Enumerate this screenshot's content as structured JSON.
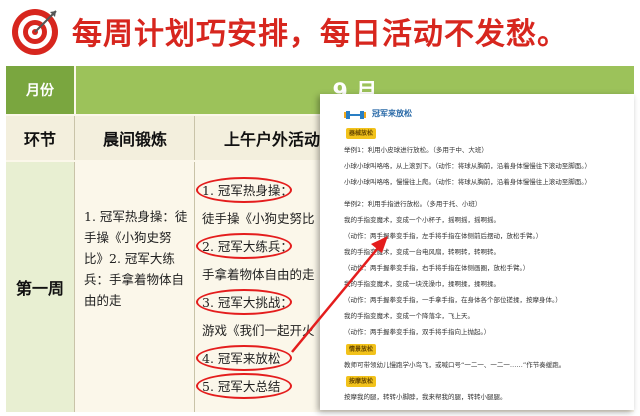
{
  "header": {
    "title": "每周计划巧安排，每日活动不发愁。"
  },
  "table": {
    "month_label": "月份",
    "month_value": "9 月",
    "col_section": "环节",
    "col_morning": "晨间锻炼",
    "col_outdoor": "上午户外活动",
    "week_label": "第一周",
    "morning_text": "1. 冠军热身操：徒手操《小狗史努比》2. 冠军大练兵：手拿着物体自由的走",
    "outdoor_lines": [
      "1. 冠军热身操：",
      "徒手操《小狗史努比",
      "2. 冠军大练兵：",
      "手拿着物体自由的走",
      "3. 冠军大挑战：",
      "游戏《我们一起开火",
      "4. 冠军来放松",
      "5. 冠军大总结"
    ]
  },
  "panel": {
    "title": "冠军来放松",
    "tag_1": "器械放松",
    "tag_2": "情景放松",
    "tag_3": "按摩放松",
    "lines": [
      "举例1：利用小皮球进行放松。（多用于中、大班）",
      "小球小球叫咯咯，从上滚到下。（动作：将球从胸前，沿着身体慢慢往下滚动至脚面。）",
      "小球小球叫咯咯，慢慢往上爬。（动作：将球从胸前，沿着身体慢慢往上滚动至脚面。）",
      "举例2：利用手指进行放松。（多用于托、小班）",
      "我的手指变魔术，变成一个小杯子，摇啊摇，摇啊摇。",
      "（动作：两手握拳变手指，左手将手指在体侧前后摆动，放松手臂。）",
      "我的手指变魔术，变成一台电风扇，转啊转，转啊转。",
      "（动作：两手握拳变手指，右手将手指在体侧画圈，放松手臂。）",
      "我的手指变魔术，变成一块洗澡巾，揉啊揉，揉啊揉。",
      "（动作：两手握拳变手指，一手拿手指，在身体各个部位搓揉，按摩身体。）",
      "我的手指变魔术，变成一个降落伞，飞上天。",
      "（动作：两手握拳变手指，双手将手指向上抛起。）",
      "教师可带领幼儿慢跑学小鸟飞，或喊口号“一二一、一二一……”作节奏缓跑。",
      "按摩我的腿，转转小脚脖，我来帮我的腿，转转小腿腿。"
    ]
  }
}
